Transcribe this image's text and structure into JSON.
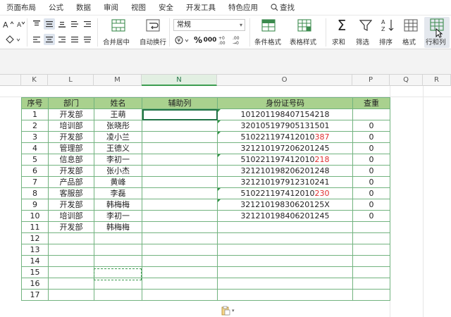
{
  "menu": [
    "页面布局",
    "公式",
    "数据",
    "审阅",
    "视图",
    "安全",
    "开发工具",
    "特色应用",
    "查找"
  ],
  "ribbon": {
    "merge_label": "合并居中",
    "wrap_label": "自动换行",
    "number_format": "常规",
    "cond_format_label": "条件格式",
    "table_style_label": "表格样式",
    "sum_label": "求和",
    "filter_label": "筛选",
    "sort_label": "排序",
    "format_label": "格式",
    "rowcol_label": "行和列"
  },
  "columns": [
    "K",
    "L",
    "M",
    "N",
    "O",
    "P",
    "Q",
    "R"
  ],
  "table": {
    "headers": [
      "序号",
      "部门",
      "姓名",
      "辅助列",
      "身份证号码",
      "查重"
    ],
    "rows": [
      {
        "seq": "1",
        "dept": "开发部",
        "name": "王萌",
        "aux": "",
        "id_pre": "101201198407154218",
        "id_red": "",
        "dup": ""
      },
      {
        "seq": "2",
        "dept": "培训部",
        "name": "张晓彤",
        "aux": "",
        "id_pre": "320105197905131501",
        "id_red": "",
        "dup": "0"
      },
      {
        "seq": "3",
        "dept": "开发部",
        "name": "凌小兰",
        "aux": "",
        "id_pre": "510221197412010",
        "id_red": "387",
        "dup": "0"
      },
      {
        "seq": "4",
        "dept": "管理部",
        "name": "王德义",
        "aux": "",
        "id_pre": "321210197206201245",
        "id_red": "",
        "dup": "0"
      },
      {
        "seq": "5",
        "dept": "信息部",
        "name": "李初一",
        "aux": "",
        "id_pre": "510221197412010",
        "id_red": "218",
        "dup": "0"
      },
      {
        "seq": "6",
        "dept": "开发部",
        "name": "张小杰",
        "aux": "",
        "id_pre": "321210198206201248",
        "id_red": "",
        "dup": "0"
      },
      {
        "seq": "7",
        "dept": "产品部",
        "name": "黄峰",
        "aux": "",
        "id_pre": "321210197912310241",
        "id_red": "",
        "dup": "0"
      },
      {
        "seq": "8",
        "dept": "客服部",
        "name": "李磊",
        "aux": "",
        "id_pre": "510221197412010",
        "id_red": "230",
        "dup": "0"
      },
      {
        "seq": "9",
        "dept": "开发部",
        "name": "韩梅梅",
        "aux": "",
        "id_pre": "32121019830620125X",
        "id_red": "",
        "dup": "0"
      },
      {
        "seq": "10",
        "dept": "培训部",
        "name": "李初一",
        "aux": "",
        "id_pre": "321210198406201245",
        "id_red": "",
        "dup": "0"
      },
      {
        "seq": "11",
        "dept": "开发部",
        "name": "韩梅梅",
        "aux": "",
        "id_pre": "",
        "id_red": "",
        "dup": ""
      },
      {
        "seq": "12",
        "dept": "",
        "name": "",
        "aux": "",
        "id_pre": "",
        "id_red": "",
        "dup": ""
      },
      {
        "seq": "13",
        "dept": "",
        "name": "",
        "aux": "",
        "id_pre": "",
        "id_red": "",
        "dup": ""
      },
      {
        "seq": "14",
        "dept": "",
        "name": "",
        "aux": "",
        "id_pre": "",
        "id_red": "",
        "dup": ""
      },
      {
        "seq": "15",
        "dept": "",
        "name": "",
        "aux": "",
        "id_pre": "",
        "id_red": "",
        "dup": ""
      },
      {
        "seq": "16",
        "dept": "",
        "name": "",
        "aux": "",
        "id_pre": "",
        "id_red": "",
        "dup": ""
      },
      {
        "seq": "17",
        "dept": "",
        "name": "",
        "aux": "",
        "id_pre": "",
        "id_red": "",
        "dup": ""
      }
    ]
  },
  "colors": {
    "header_fill": "#a9d18e",
    "border_green": "#72b37f",
    "accent_red": "#e03030",
    "selection_green": "#217346"
  }
}
